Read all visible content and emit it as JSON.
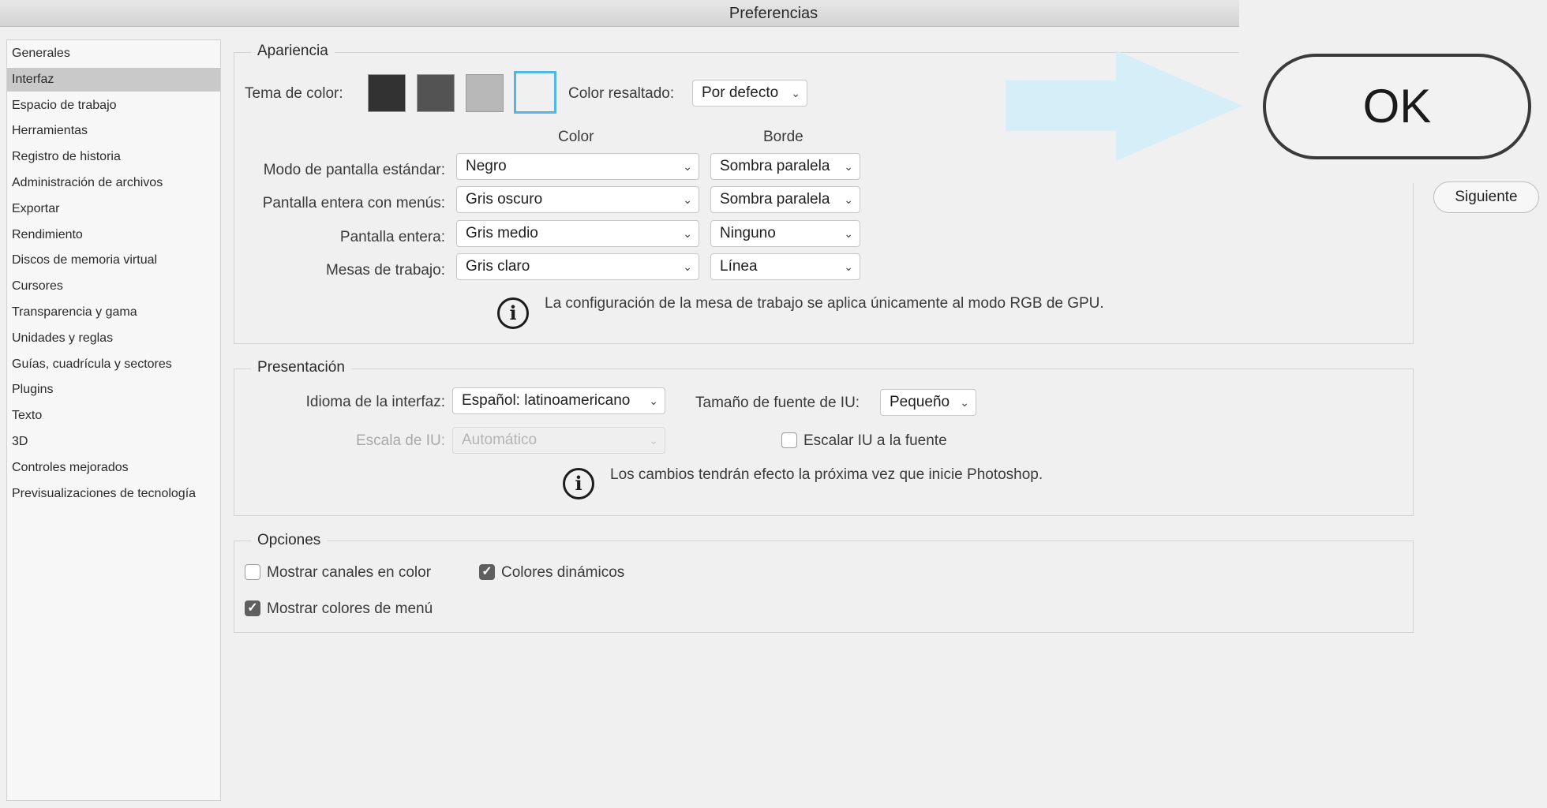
{
  "window": {
    "title": "Preferencias"
  },
  "sidebar": {
    "selected_index": 1,
    "items": [
      {
        "label": "Generales"
      },
      {
        "label": "Interfaz"
      },
      {
        "label": "Espacio de trabajo"
      },
      {
        "label": "Herramientas"
      },
      {
        "label": "Registro de historia"
      },
      {
        "label": "Administración de archivos"
      },
      {
        "label": "Exportar"
      },
      {
        "label": "Rendimiento"
      },
      {
        "label": "Discos de memoria virtual"
      },
      {
        "label": "Cursores"
      },
      {
        "label": "Transparencia y gama"
      },
      {
        "label": "Unidades y reglas"
      },
      {
        "label": "Guías, cuadrícula y sectores"
      },
      {
        "label": "Plugins"
      },
      {
        "label": "Texto"
      },
      {
        "label": "3D"
      },
      {
        "label": "Controles mejorados"
      },
      {
        "label": "Previsualizaciones de tecnología"
      }
    ]
  },
  "appearance": {
    "legend": "Apariencia",
    "theme_label": "Tema de color:",
    "swatches": [
      {
        "color": "#323232"
      },
      {
        "color": "#535353"
      },
      {
        "color": "#b8b8b8"
      },
      {
        "color": "#f0f0f1",
        "selected": true
      }
    ],
    "highlight_label": "Color resaltado:",
    "highlight_value": "Por defecto",
    "col_color": "Color",
    "col_border": "Borde",
    "rows": [
      {
        "label": "Modo de pantalla estándar:",
        "color": "Negro",
        "border": "Sombra paralela"
      },
      {
        "label": "Pantalla entera con menús:",
        "color": "Gris oscuro",
        "border": "Sombra paralela"
      },
      {
        "label": "Pantalla entera:",
        "color": "Gris medio",
        "border": "Ninguno"
      },
      {
        "label": "Mesas de trabajo:",
        "color": "Gris claro",
        "border": "Línea"
      }
    ],
    "note": "La configuración de la mesa de trabajo se aplica únicamente al modo RGB de GPU."
  },
  "presentation": {
    "legend": "Presentación",
    "language_label": "Idioma de la interfaz:",
    "language_value": "Español: latinoamericano",
    "font_size_label": "Tamaño de fuente de IU:",
    "font_size_value": "Pequeño",
    "scale_label": "Escala de IU:",
    "scale_value": "Automático",
    "scale_to_font_label": "Escalar IU a la fuente",
    "scale_to_font_checked": false,
    "note": "Los cambios tendrán efecto la próxima vez que inicie Photoshop."
  },
  "options": {
    "legend": "Opciones",
    "show_channels_label": "Mostrar canales en color",
    "show_channels_checked": false,
    "dynamic_colors_label": "Colores dinámicos",
    "dynamic_colors_checked": true,
    "menu_colors_label": "Mostrar colores de menú",
    "menu_colors_checked": true
  },
  "buttons": {
    "ok": "OK",
    "next": "Siguiente"
  },
  "colors": {
    "arrow": "#d6eef8",
    "swatch_selected_border": "#4fb6e6"
  },
  "icons": {
    "info": "info-icon",
    "chevron": "chevron-down-icon",
    "check": "checkmark-icon",
    "arrow": "arrow-right-icon"
  }
}
